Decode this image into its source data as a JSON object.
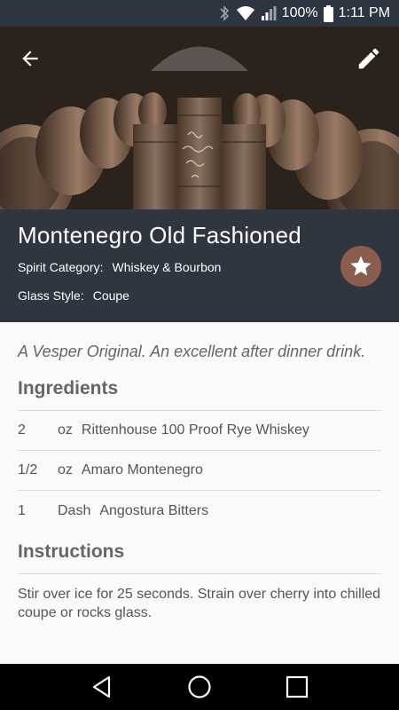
{
  "status_bar": {
    "battery": "100%",
    "time": "1:11 PM",
    "icons": [
      "bluetooth-icon",
      "wifi-icon",
      "signal-icon",
      "battery-icon"
    ]
  },
  "hero": {
    "back_icon": "arrow-back-icon",
    "edit_icon": "pencil-icon"
  },
  "drink": {
    "name": "Montenegro Old Fashioned",
    "spirit_label": "Spirit Category:",
    "spirit_value": "Whiskey & Bourbon",
    "glass_label": "Glass Style:",
    "glass_value": "Coupe",
    "favorite_icon": "star-icon",
    "favorite_color": "#8b5d4e"
  },
  "content": {
    "description": "A Vesper Original. An excellent after dinner drink.",
    "ingredients_title": "Ingredients",
    "ingredients": [
      {
        "qty": "2",
        "unit": "oz",
        "name": "Rittenhouse 100 Proof Rye Whiskey"
      },
      {
        "qty": "1/2",
        "unit": "oz",
        "name": "Amaro Montenegro"
      },
      {
        "qty": "1",
        "unit": "Dash",
        "name": "Angostura Bitters"
      }
    ],
    "instructions_title": "Instructions",
    "instructions": "Stir over ice for 25 seconds.  Strain over cherry into chilled coupe or rocks glass."
  },
  "nav": {
    "back_icon": "nav-back-icon",
    "home_icon": "nav-home-icon",
    "recents_icon": "nav-recents-icon"
  }
}
